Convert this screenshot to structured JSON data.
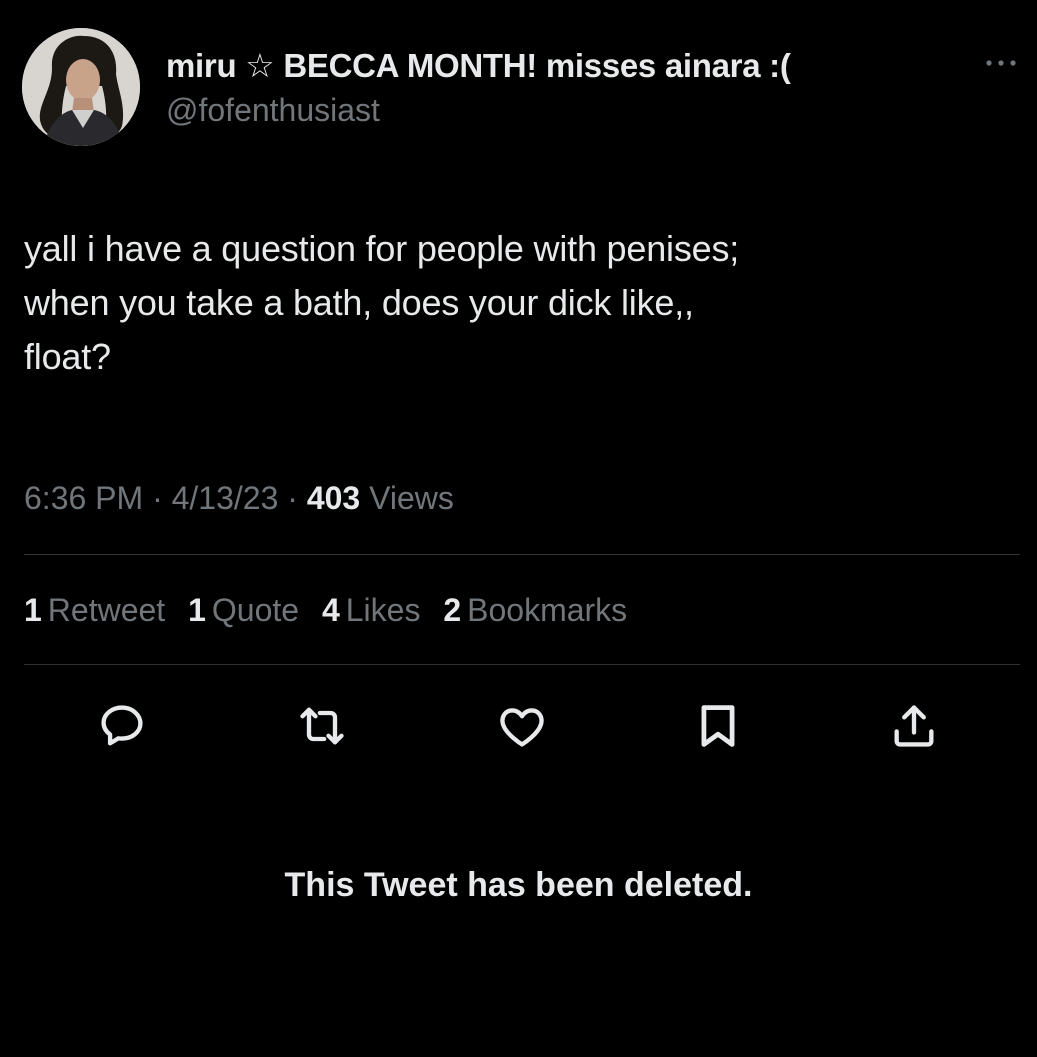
{
  "tweet": {
    "author": {
      "display_name": "miru ☆ BECCA MONTH! misses ainara :(",
      "handle": "@fofenthusiast"
    },
    "text": "yall i have a question for people with penises;\nwhen you take a bath, does your dick like,,\nfloat?",
    "meta": {
      "time": "6:36 PM",
      "separator": "·",
      "date": "4/13/23",
      "views_count": "403",
      "views_label": "Views"
    },
    "stats": [
      {
        "count": "1",
        "label": "Retweet"
      },
      {
        "count": "1",
        "label": "Quote"
      },
      {
        "count": "4",
        "label": "Likes"
      },
      {
        "count": "2",
        "label": "Bookmarks"
      }
    ],
    "actions": [
      {
        "icon": "reply-icon"
      },
      {
        "icon": "retweet-icon"
      },
      {
        "icon": "like-icon"
      },
      {
        "icon": "bookmark-icon"
      },
      {
        "icon": "share-icon"
      }
    ]
  },
  "notice": "This Tweet has been deleted.",
  "colors": {
    "background": "#000000",
    "primary_text": "#e7e9ea",
    "secondary_text": "#71767b",
    "divider": "#2f3336"
  }
}
